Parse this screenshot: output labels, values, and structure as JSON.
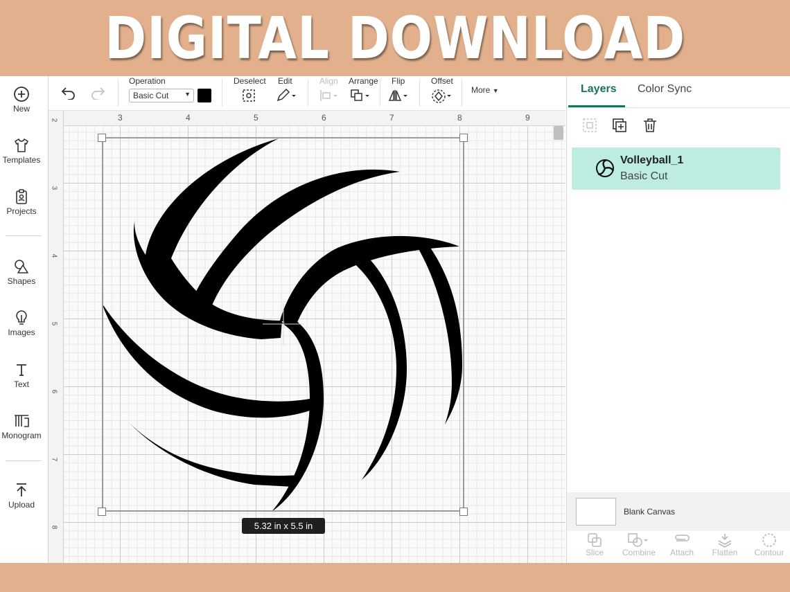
{
  "banner": {
    "title": "DIGITAL DOWNLOAD"
  },
  "sidebar": {
    "items": [
      {
        "label": "New",
        "icon": "plus-circle-icon"
      },
      {
        "label": "Templates",
        "icon": "tshirt-icon"
      },
      {
        "label": "Projects",
        "icon": "clipboard-icon"
      },
      {
        "label": "Shapes",
        "icon": "shapes-icon"
      },
      {
        "label": "Images",
        "icon": "lightbulb-icon"
      },
      {
        "label": "Text",
        "icon": "text-icon"
      },
      {
        "label": "Monogram",
        "icon": "monogram-icon"
      },
      {
        "label": "Upload",
        "icon": "upload-icon"
      }
    ]
  },
  "toolbar": {
    "operation_label": "Operation",
    "operation_value": "Basic Cut",
    "operation_color": "#000000",
    "deselect": "Deselect",
    "edit": "Edit",
    "align": "Align",
    "arrange": "Arrange",
    "flip": "Flip",
    "offset": "Offset",
    "more": "More"
  },
  "ruler": {
    "top": [
      "3",
      "4",
      "5",
      "6",
      "7",
      "8",
      "9"
    ],
    "left": [
      "2",
      "3",
      "4",
      "5",
      "6",
      "7",
      "8"
    ]
  },
  "canvas": {
    "dimensions": "5.32  in x 5.5  in"
  },
  "panel": {
    "tabs": [
      "Layers",
      "Color Sync"
    ],
    "active_tab": "Layers",
    "layer": {
      "name": "Volleyball_1",
      "operation": "Basic Cut"
    },
    "blank_canvas": "Blank Canvas",
    "bottom_tools": [
      "Slice",
      "Combine",
      "Attach",
      "Flatten",
      "Contour"
    ]
  },
  "colors": {
    "accent": "#19705c",
    "layer_highlight": "#bdece0",
    "banner_bg": "#e2b08c"
  }
}
